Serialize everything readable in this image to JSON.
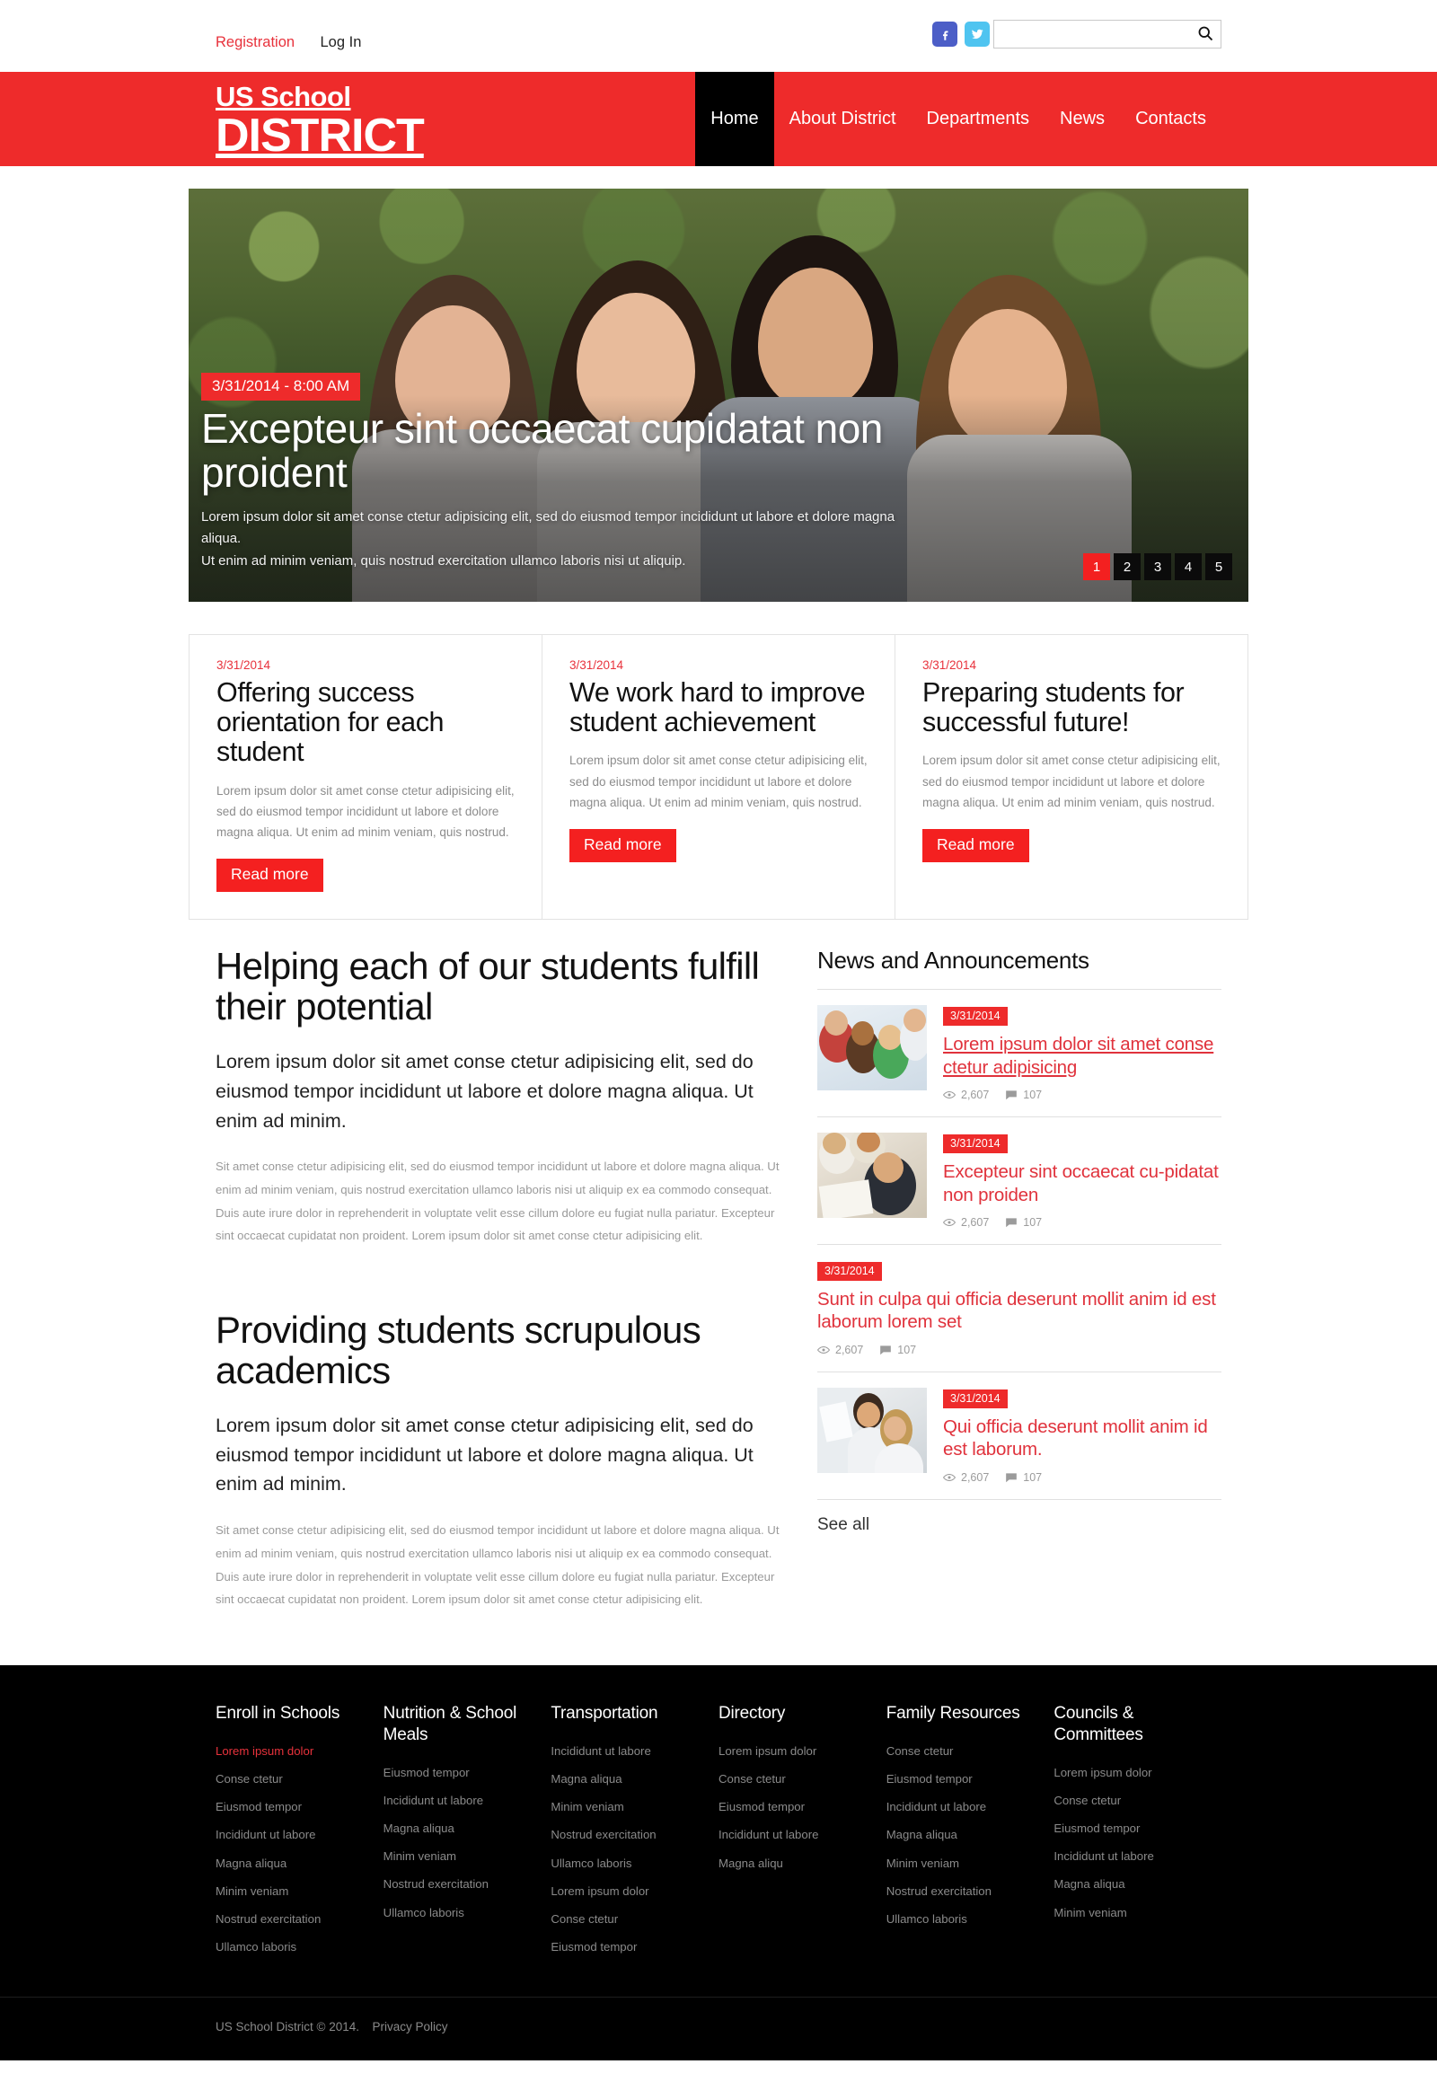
{
  "topbar": {
    "registration_label": "Registration",
    "login_label": "Log In",
    "social": [
      {
        "name": "facebook-icon",
        "label": "Facebook"
      },
      {
        "name": "twitter-icon",
        "label": "Twitter"
      }
    ],
    "search": {
      "value": "",
      "placeholder": "",
      "icon": "search-icon"
    }
  },
  "header": {
    "brand_line1": "US School",
    "brand_line2": "DISTRICT",
    "nav": [
      {
        "label": "Home",
        "active": true
      },
      {
        "label": "About District",
        "active": false
      },
      {
        "label": "Departments",
        "active": false
      },
      {
        "label": "News",
        "active": false
      },
      {
        "label": "Contacts",
        "active": false
      }
    ]
  },
  "hero": {
    "date": "3/31/2014  -  8:00 AM",
    "title": "Excepteur sint occaecat cupidatat non proident",
    "subtitle_line1": "Lorem ipsum dolor sit amet conse ctetur adipisicing elit, sed do eiusmod tempor incididunt ut labore et dolore magna aliqua.",
    "subtitle_line2": "Ut enim ad minim veniam, quis nostrud exercitation ullamco laboris nisi ut aliquip.",
    "pager": [
      "1",
      "2",
      "3",
      "4",
      "5"
    ],
    "pager_active": "1"
  },
  "cards": [
    {
      "date": "3/31/2014",
      "title": "Offering success orientation for each student",
      "text": "Lorem ipsum dolor sit amet conse ctetur adipisicing elit, sed do eiusmod tempor incididunt ut labore et dolore magna aliqua. Ut enim ad minim veniam, quis nostrud.",
      "button": "Read more"
    },
    {
      "date": "3/31/2014",
      "title": "We work hard to improve student achievement",
      "text": "Lorem ipsum dolor sit amet conse ctetur adipisicing elit, sed do eiusmod tempor incididunt ut labore et dolore magna aliqua. Ut enim ad minim veniam, quis nostrud.",
      "button": "Read more"
    },
    {
      "date": "3/31/2014",
      "title": "Preparing students for successful future!",
      "text": "Lorem ipsum dolor sit amet conse ctetur adipisicing elit, sed do eiusmod tempor incididunt ut labore et dolore magna aliqua. Ut enim ad minim veniam, quis nostrud.",
      "button": "Read more"
    }
  ],
  "sections": [
    {
      "heading": "Helping each of our students fulfill their potential",
      "lead": "Lorem ipsum dolor sit amet conse ctetur adipisicing elit, sed do eiusmod tempor incididunt ut labore et dolore magna aliqua. Ut enim ad minim.",
      "body": "Sit amet conse ctetur adipisicing elit, sed do eiusmod tempor incididunt ut labore et dolore magna aliqua. Ut enim ad minim veniam, quis nostrud exercitation ullamco laboris nisi ut aliquip ex ea commodo consequat. Duis aute irure dolor in reprehenderit in voluptate velit esse cillum dolore eu fugiat nulla pariatur. Excepteur sint occaecat cupidatat non proident. Lorem ipsum dolor sit amet conse ctetur adipisicing elit."
    },
    {
      "heading": "Providing students scrupulous academics",
      "lead": "Lorem ipsum dolor sit amet conse ctetur adipisicing elit, sed do eiusmod tempor incididunt ut labore et dolore magna aliqua. Ut enim ad minim.",
      "body": "Sit amet conse ctetur adipisicing elit, sed do eiusmod tempor incididunt ut labore et dolore magna aliqua. Ut enim ad minim veniam, quis nostrud exercitation ullamco laboris nisi ut aliquip ex ea commodo consequat. Duis aute irure dolor in reprehenderit in voluptate velit esse cillum dolore eu fugiat nulla pariatur. Excepteur sint occaecat cupidatat non proident. Lorem ipsum dolor sit amet conse ctetur adipisicing elit."
    }
  ],
  "news": {
    "heading": "News and Announcements",
    "see_all": "See all",
    "items": [
      {
        "date": "3/31/2014",
        "title": "Lorem ipsum dolor sit amet conse ctetur adipisicing",
        "views": "2,607",
        "comments": "107",
        "has_thumb": true
      },
      {
        "date": "3/31/2014",
        "title": "Excepteur sint occaecat cu-pidatat non proiden",
        "views": "2,607",
        "comments": "107",
        "has_thumb": true
      },
      {
        "date": "3/31/2014",
        "title": "Sunt in culpa qui officia deserunt mollit anim id est laborum lorem set",
        "views": "2,607",
        "comments": "107",
        "has_thumb": false
      },
      {
        "date": "3/31/2014",
        "title": "Qui officia deserunt mollit anim id est laborum.",
        "views": "2,607",
        "comments": "107",
        "has_thumb": true
      }
    ]
  },
  "footer": {
    "columns": [
      {
        "title": "Enroll in Schools",
        "links": [
          "Lorem ipsum dolor",
          "Conse ctetur",
          "Eiusmod tempor",
          "Incididunt ut labore",
          "Magna aliqua",
          "Minim veniam",
          "Nostrud exercitation",
          "Ullamco laboris"
        ],
        "highlight_index": 0
      },
      {
        "title": "Nutrition & School Meals",
        "links": [
          "Eiusmod tempor",
          "Incididunt ut labore",
          "Magna aliqua",
          "Minim veniam",
          "Nostrud exercitation",
          "Ullamco laboris"
        ],
        "highlight_index": -1
      },
      {
        "title": "Transportation",
        "links": [
          "Incididunt ut labore",
          "Magna aliqua",
          "Minim veniam",
          "Nostrud exercitation",
          "Ullamco laboris",
          "Lorem ipsum dolor",
          "Conse ctetur",
          "Eiusmod tempor"
        ],
        "highlight_index": -1
      },
      {
        "title": "Directory",
        "links": [
          "Lorem ipsum dolor",
          "Conse ctetur",
          "Eiusmod tempor",
          "Incididunt ut labore",
          "Magna aliqu"
        ],
        "highlight_index": -1
      },
      {
        "title": "Family Resources",
        "links": [
          "Conse ctetur",
          "Eiusmod tempor",
          "Incididunt ut labore",
          "Magna aliqua",
          "Minim veniam",
          "Nostrud exercitation",
          "Ullamco laboris"
        ],
        "highlight_index": -1
      },
      {
        "title": "Councils & Committees",
        "links": [
          "Lorem ipsum dolor",
          "Conse ctetur",
          "Eiusmod tempor",
          "Incididunt ut labore",
          "Magna aliqua",
          "Minim veniam"
        ],
        "highlight_index": -1
      }
    ],
    "copyright": "US School District  © 2014.",
    "privacy": "Privacy Policy"
  },
  "colors": {
    "brand_red": "#ee2b2b",
    "link_red": "#e8323c",
    "button_red": "#f42020",
    "black": "#000000"
  }
}
